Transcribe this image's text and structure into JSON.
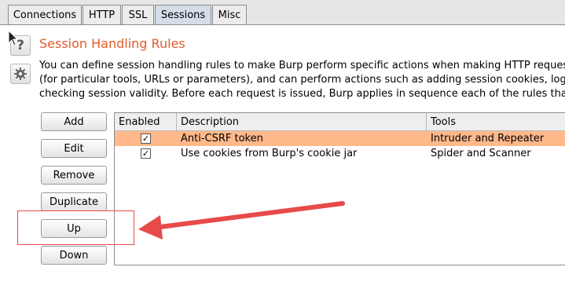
{
  "tabs": [
    {
      "label": "Connections"
    },
    {
      "label": "HTTP"
    },
    {
      "label": "SSL"
    },
    {
      "label": "Sessions",
      "active": true
    },
    {
      "label": "Misc"
    }
  ],
  "section": {
    "title": "Session Handling Rules",
    "description": [
      "You can define session handling rules to make Burp perform specific actions when making HTTP requests",
      "(for particular tools, URLs or parameters), and can perform actions such as adding session cookies, loggi",
      "checking session validity. Before each request is issued, Burp applies in sequence each of the rules that a"
    ]
  },
  "buttons": {
    "add": "Add",
    "edit": "Edit",
    "remove": "Remove",
    "duplicate": "Duplicate",
    "up": "Up",
    "down": "Down"
  },
  "table": {
    "columns": [
      "Enabled",
      "Description",
      "Tools"
    ],
    "rows": [
      {
        "enabled": true,
        "description": "Anti-CSRF token",
        "tools": "Intruder and Repeater",
        "selected": true
      },
      {
        "enabled": true,
        "description": "Use cookies from Burp's cookie jar",
        "tools": "Spider and Scanner",
        "selected": false
      }
    ]
  },
  "colors": {
    "accent_title": "#e35b2a",
    "selected_row": "#ffb98b",
    "annotation_red": "#e84a4a"
  }
}
